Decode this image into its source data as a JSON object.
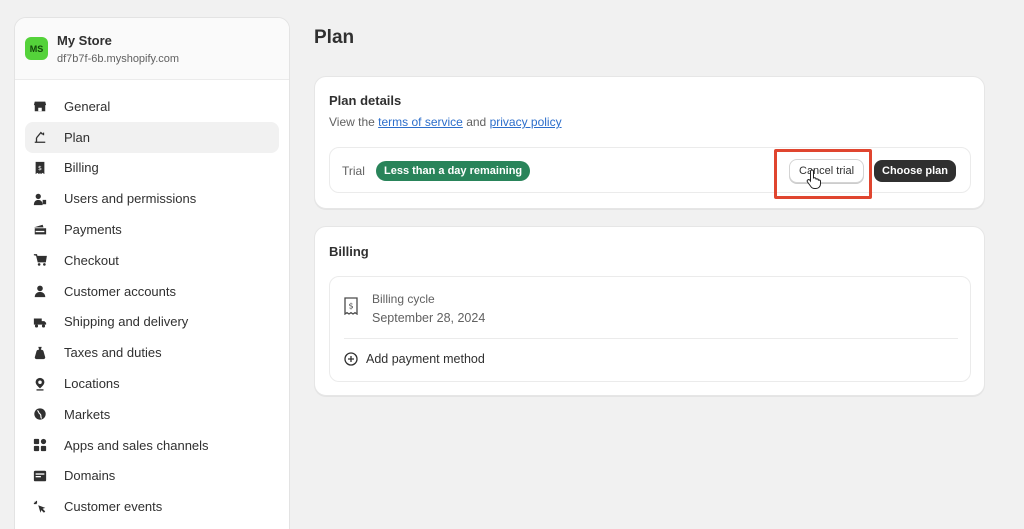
{
  "store": {
    "initials": "MS",
    "name": "My Store",
    "domain": "df7b7f-6b.myshopify.com"
  },
  "nav": [
    {
      "label": "General",
      "icon": "store-icon"
    },
    {
      "label": "Plan",
      "icon": "plan-icon",
      "active": true
    },
    {
      "label": "Billing",
      "icon": "receipt-icon"
    },
    {
      "label": "Users and permissions",
      "icon": "users-icon"
    },
    {
      "label": "Payments",
      "icon": "payments-icon"
    },
    {
      "label": "Checkout",
      "icon": "cart-icon"
    },
    {
      "label": "Customer accounts",
      "icon": "person-icon"
    },
    {
      "label": "Shipping and delivery",
      "icon": "truck-icon"
    },
    {
      "label": "Taxes and duties",
      "icon": "tax-bag-icon"
    },
    {
      "label": "Locations",
      "icon": "location-pin-icon"
    },
    {
      "label": "Markets",
      "icon": "globe-icon"
    },
    {
      "label": "Apps and sales channels",
      "icon": "apps-icon"
    },
    {
      "label": "Domains",
      "icon": "domain-icon"
    },
    {
      "label": "Customer events",
      "icon": "cursor-click-icon"
    }
  ],
  "page": {
    "title": "Plan"
  },
  "plan_card": {
    "title": "Plan details",
    "view_text": "View the",
    "terms_link": "terms of service",
    "and_text": "and",
    "privacy_link": "privacy policy",
    "trial_label": "Trial",
    "badge": "Less than a day remaining",
    "cancel_button": "Cancel trial",
    "choose_button": "Choose plan"
  },
  "billing_card": {
    "title": "Billing",
    "cycle_label": "Billing cycle",
    "cycle_date": "September 28, 2024",
    "add_payment": "Add payment method"
  },
  "colors": {
    "badge": "#29845a",
    "highlight": "#e0452f",
    "link": "#2c6ecb",
    "primary_button": "#303030"
  }
}
